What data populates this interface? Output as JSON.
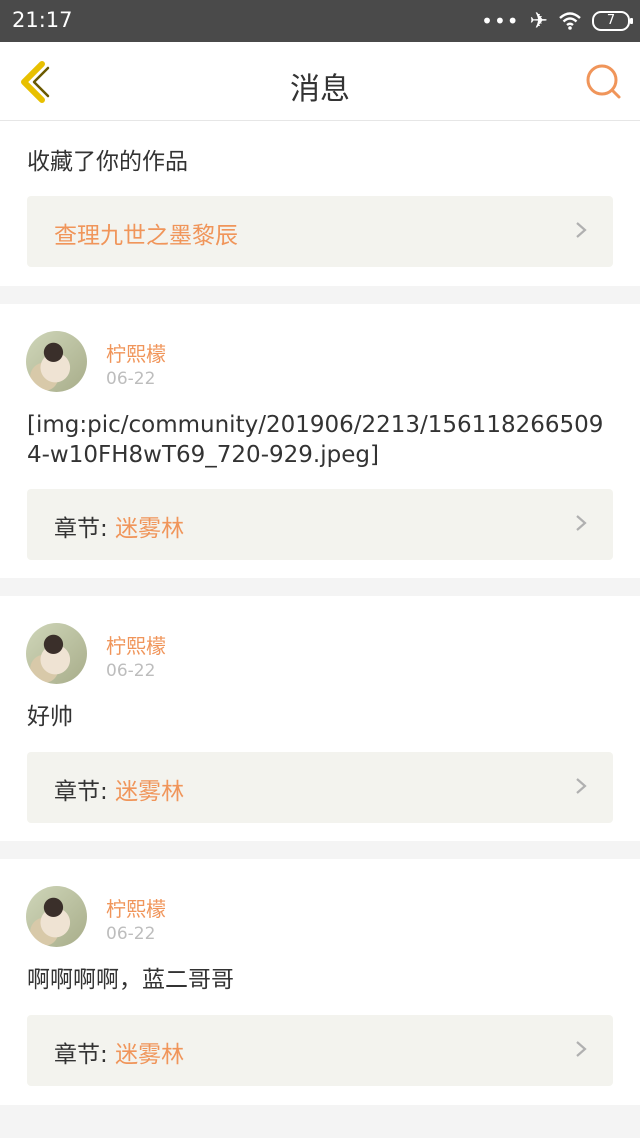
{
  "status_bar": {
    "time": "21:17",
    "battery": "7"
  },
  "header": {
    "title": "消息"
  },
  "first_card": {
    "text": "收藏了你的作品",
    "link_text": "查理九世之墨黎辰"
  },
  "items": [
    {
      "user": "柠熙檬",
      "date": "06-22",
      "message": "[img:pic/community/201906/2213/1561182665094-w10FH8wT69_720-929.jpeg]",
      "chapter_label": "章节:",
      "chapter_name": "迷雾林"
    },
    {
      "user": "柠熙檬",
      "date": "06-22",
      "message": "好帅",
      "chapter_label": "章节:",
      "chapter_name": "迷雾林"
    },
    {
      "user": "柠熙檬",
      "date": "06-22",
      "message": "啊啊啊啊，蓝二哥哥",
      "chapter_label": "章节:",
      "chapter_name": "迷雾林"
    }
  ],
  "colors": {
    "accent": "#f0955a",
    "back_icon": "#e8c000",
    "link_bg": "#f3f3ee"
  }
}
